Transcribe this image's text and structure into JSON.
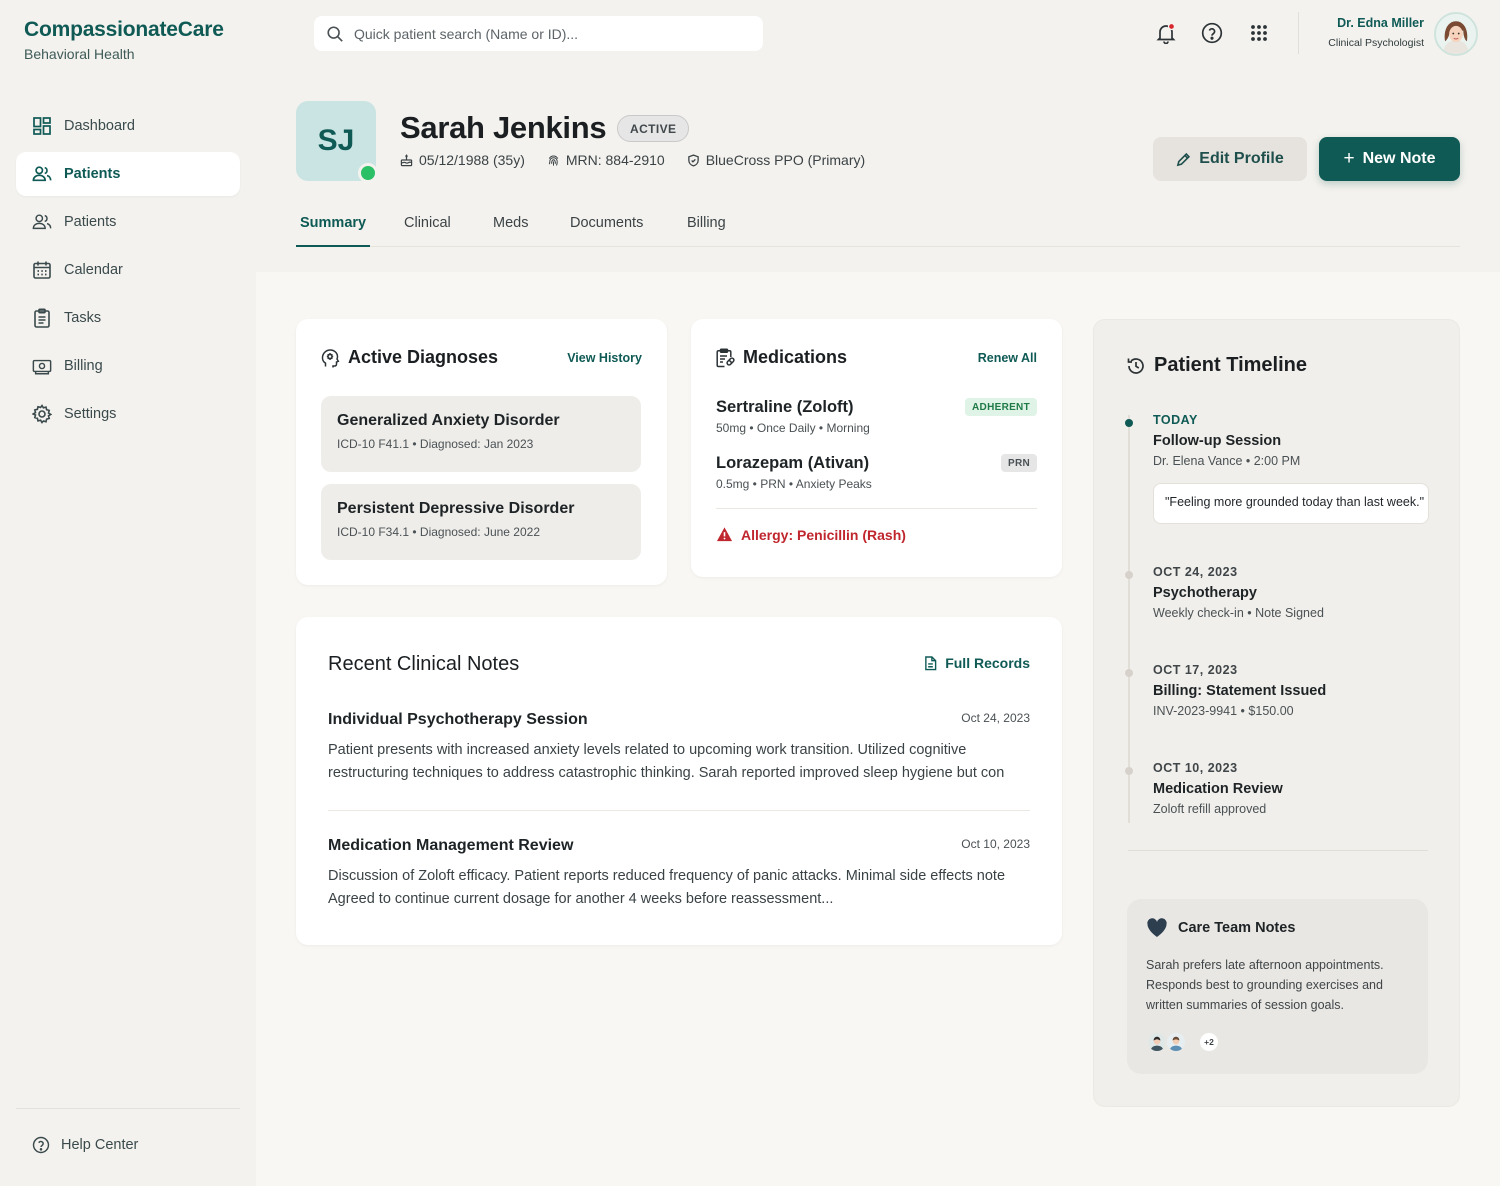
{
  "brand": {
    "name": "CompassionateCare",
    "subtitle": "Behavioral Health"
  },
  "sidebar": {
    "items": [
      {
        "label": "Dashboard",
        "icon": "dashboard-icon",
        "active": false
      },
      {
        "label": "Patients",
        "icon": "users-icon",
        "active": true
      },
      {
        "label": "Patients",
        "icon": "users-icon",
        "active": false
      },
      {
        "label": "Calendar",
        "icon": "calendar-icon",
        "active": false
      },
      {
        "label": "Tasks",
        "icon": "clipboard-icon",
        "active": false
      },
      {
        "label": "Billing",
        "icon": "billing-icon",
        "active": false
      },
      {
        "label": "Settings",
        "icon": "gear-icon",
        "active": false
      }
    ],
    "help_label": "Help Center"
  },
  "header": {
    "search_placeholder": "Quick patient search (Name or ID)...",
    "user_name": "Dr. Edna Miller",
    "user_role": "Clinical Psychologist"
  },
  "patient": {
    "initials": "SJ",
    "name": "Sarah Jenkins",
    "status": "ACTIVE",
    "dob": "05/12/1988 (35y)",
    "mrn": "MRN: 884-2910",
    "insurance": "BlueCross PPO (Primary)",
    "edit_label": "Edit Profile",
    "new_note_label": "New Note"
  },
  "tabs": [
    "Summary",
    "Clinical",
    "Meds",
    "Documents",
    "Billing"
  ],
  "diagnoses": {
    "title": "Active Diagnoses",
    "link": "View History",
    "items": [
      {
        "name": "Generalized Anxiety Disorder",
        "detail": "ICD-10 F41.1 • Diagnosed: Jan 2023"
      },
      {
        "name": "Persistent Depressive Disorder",
        "detail": "ICD-10 F34.1 • Diagnosed: June 2022"
      }
    ]
  },
  "medications": {
    "title": "Medications",
    "link": "Renew All",
    "items": [
      {
        "name": "Sertraline (Zoloft)",
        "detail": "50mg • Once Daily • Morning",
        "badge": "ADHERENT"
      },
      {
        "name": "Lorazepam (Ativan)",
        "detail": "0.5mg • PRN • Anxiety Peaks",
        "badge": "PRN"
      }
    ],
    "allergy": "Allergy: Penicillin (Rash)"
  },
  "notes": {
    "title": "Recent Clinical Notes",
    "link": "Full Records",
    "items": [
      {
        "title": "Individual Psychotherapy Session",
        "date": "Oct 24, 2023",
        "line1": "Patient presents with increased anxiety levels related to upcoming work transition. Utilized cognitive",
        "line2": "restructuring techniques to address catastrophic thinking. Sarah reported improved sleep hygiene but con"
      },
      {
        "title": "Medication Management Review",
        "date": "Oct 10, 2023",
        "line1": "Discussion of Zoloft efficacy. Patient reports reduced frequency of panic attacks. Minimal side effects note",
        "line2": "Agreed to continue current dosage for another 4 weeks before reassessment..."
      }
    ]
  },
  "timeline": {
    "title": "Patient Timeline",
    "items": [
      {
        "date": "TODAY",
        "title": "Follow-up Session",
        "detail": "Dr. Elena Vance • 2:00 PM",
        "quote": "\"Feeling more grounded today than last week.\""
      },
      {
        "date": "OCT 24, 2023",
        "title": "Psychotherapy",
        "detail": "Weekly check-in • Note Signed"
      },
      {
        "date": "OCT 17, 2023",
        "title": "Billing: Statement Issued",
        "detail": "INV-2023-9941 • $150.00"
      },
      {
        "date": "OCT 10, 2023",
        "title": "Medication Review",
        "detail": "Zoloft refill approved"
      }
    ],
    "care_team": {
      "title": "Care Team Notes",
      "body": "Sarah prefers late afternoon appointments. Responds best to grounding exercises and written summaries of session goals.",
      "more": "+2"
    }
  },
  "colors": {
    "brand": "#0f5a55",
    "alert": "#c0262d",
    "online": "#2bbf66",
    "adherent_bg": "#dff3e7",
    "adherent_text": "#1f7a46"
  }
}
